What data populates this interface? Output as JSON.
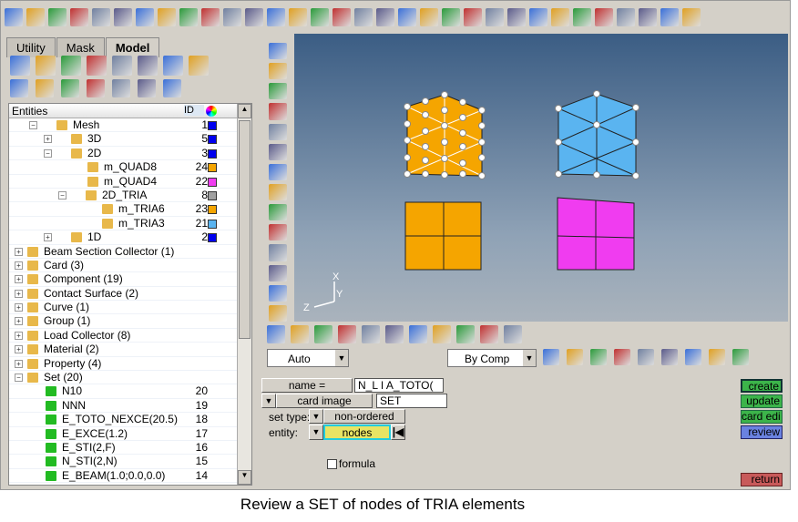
{
  "tabs": [
    {
      "label": "Utility"
    },
    {
      "label": "Mask"
    },
    {
      "label": "Model",
      "active": true
    }
  ],
  "tree": {
    "header": {
      "entities": "Entities",
      "id": "ID"
    },
    "rows": [
      {
        "label": "Mesh",
        "id": "1",
        "color": "#0000ee",
        "indent": 1,
        "exp": "-"
      },
      {
        "label": "3D",
        "id": "5",
        "color": "#0000ee",
        "indent": 2,
        "exp": "+"
      },
      {
        "label": "2D",
        "id": "3",
        "color": "#0000ee",
        "indent": 2,
        "exp": "-"
      },
      {
        "label": "m_QUAD8",
        "id": "24",
        "color": "#f5a500",
        "indent": 3
      },
      {
        "label": "m_QUAD4",
        "id": "22",
        "color": "#f03cf0",
        "indent": 3
      },
      {
        "label": "2D_TRIA",
        "id": "8",
        "color": "#a0a0a0",
        "indent": 3,
        "exp": "-"
      },
      {
        "label": "m_TRIA6",
        "id": "23",
        "color": "#f5a500",
        "indent": 4
      },
      {
        "label": "m_TRIA3",
        "id": "21",
        "color": "#5ab4f0",
        "indent": 4
      },
      {
        "label": "1D",
        "id": "2",
        "color": "#0000ee",
        "indent": 2,
        "exp": "+"
      },
      {
        "label": "Beam Section Collector (1)",
        "indent": 0,
        "exp": "+"
      },
      {
        "label": "Card (3)",
        "indent": 0,
        "exp": "+"
      },
      {
        "label": "Component (19)",
        "indent": 0,
        "exp": "+"
      },
      {
        "label": "Contact Surface (2)",
        "indent": 0,
        "exp": "+"
      },
      {
        "label": "Curve (1)",
        "indent": 0,
        "exp": "+"
      },
      {
        "label": "Group (1)",
        "indent": 0,
        "exp": "+"
      },
      {
        "label": "Load Collector (8)",
        "indent": 0,
        "exp": "+"
      },
      {
        "label": "Material (2)",
        "indent": 0,
        "exp": "+"
      },
      {
        "label": "Property (4)",
        "indent": 0,
        "exp": "+"
      },
      {
        "label": "Set (20)",
        "indent": 0,
        "exp": "-"
      },
      {
        "label": "N10",
        "id": "20",
        "indent": 1,
        "set": true
      },
      {
        "label": "NNN",
        "id": "19",
        "indent": 1,
        "set": true
      },
      {
        "label": "E_TOTO_NEXCE(20.5)",
        "id": "18",
        "indent": 1,
        "set": true
      },
      {
        "label": "E_EXCE(1.2)",
        "id": "17",
        "indent": 1,
        "set": true
      },
      {
        "label": "E_STI(2,F)",
        "id": "16",
        "indent": 1,
        "set": true
      },
      {
        "label": "N_STI(2,N)",
        "id": "15",
        "indent": 1,
        "set": true
      },
      {
        "label": "E_BEAM(1.0;0.0,0.0)",
        "id": "14",
        "indent": 1,
        "set": true
      }
    ]
  },
  "viewport": {
    "axis_x": "X",
    "axis_y": "Y",
    "axis_z": "Z",
    "colors": {
      "tria6": "#f5a500",
      "tria3": "#5ab4f0",
      "quad8": "#f5a500",
      "quad4": "#f03cf0"
    }
  },
  "bottom_toolbar": {
    "auto": "Auto",
    "by_comp": "By Comp"
  },
  "panel": {
    "name_label": "name =",
    "name_value": "N_L I A_TOTO(",
    "card_image_label": "card image",
    "card_image_value": "SET",
    "set_type_label": "set type:",
    "set_type_value": "non-ordered",
    "entity_label": "entity:",
    "entity_value": "nodes",
    "formula_label": "formula",
    "create": "create",
    "update": "update",
    "card_edit": "card edi",
    "review": "review",
    "return": "return"
  },
  "caption": "Review a SET of nodes of TRIA elements"
}
